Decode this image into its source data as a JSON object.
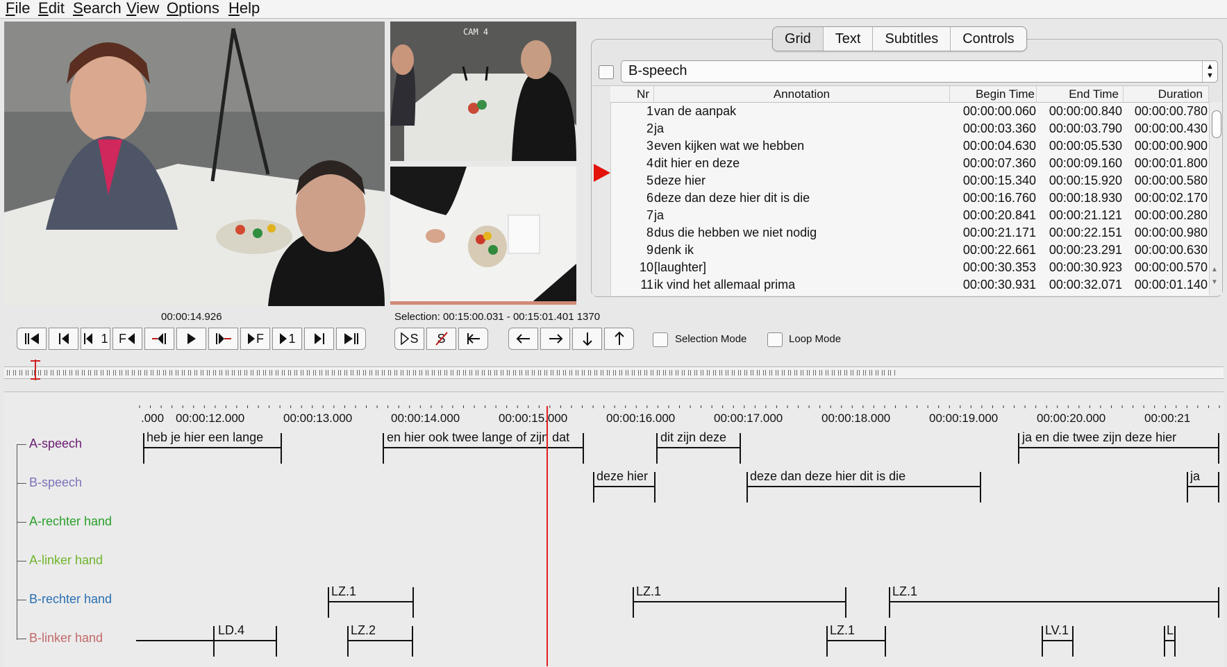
{
  "menu": [
    {
      "label": "File",
      "mnemonic": "F",
      "rest": "ile"
    },
    {
      "label": "Edit",
      "mnemonic": "E",
      "rest": "dit"
    },
    {
      "label": "Search",
      "mnemonic": "S",
      "rest": "earch"
    },
    {
      "label": "View",
      "mnemonic": "V",
      "rest": "iew"
    },
    {
      "label": "Options",
      "mnemonic": "O",
      "rest": "ptions"
    },
    {
      "label": "Help",
      "mnemonic": "H",
      "rest": "elp"
    }
  ],
  "video": {
    "cam_label": "CAM 4"
  },
  "player": {
    "current_time": "00:00:14.926",
    "selection": "Selection: 00:15:00.031 - 00:15:01.401  1370"
  },
  "tabs": [
    "Grid",
    "Text",
    "Subtitles",
    "Controls"
  ],
  "active_tab": "Grid",
  "tier_select": {
    "value": "B-speech"
  },
  "table": {
    "headers": {
      "nr": "Nr",
      "annotation": "Annotation",
      "begin": "Begin Time",
      "end": "End Time",
      "duration": "Duration"
    },
    "rows": [
      {
        "nr": "1",
        "annotation": "van de aanpak",
        "begin": "00:00:00.060",
        "end": "00:00:00.840",
        "duration": "00:00:00.780"
      },
      {
        "nr": "2",
        "annotation": "ja",
        "begin": "00:00:03.360",
        "end": "00:00:03.790",
        "duration": "00:00:00.430"
      },
      {
        "nr": "3",
        "annotation": "even kijken wat we hebben",
        "begin": "00:00:04.630",
        "end": "00:00:05.530",
        "duration": "00:00:00.900"
      },
      {
        "nr": "4",
        "annotation": "dit hier en deze",
        "begin": "00:00:07.360",
        "end": "00:00:09.160",
        "duration": "00:00:01.800"
      },
      {
        "nr": "5",
        "annotation": "deze hier",
        "begin": "00:00:15.340",
        "end": "00:00:15.920",
        "duration": "00:00:00.580"
      },
      {
        "nr": "6",
        "annotation": "deze dan deze hier dit is die",
        "begin": "00:00:16.760",
        "end": "00:00:18.930",
        "duration": "00:00:02.170"
      },
      {
        "nr": "7",
        "annotation": "ja",
        "begin": "00:00:20.841",
        "end": "00:00:21.121",
        "duration": "00:00:00.280"
      },
      {
        "nr": "8",
        "annotation": "dus die hebben we niet nodig",
        "begin": "00:00:21.171",
        "end": "00:00:22.151",
        "duration": "00:00:00.980"
      },
      {
        "nr": "9",
        "annotation": "denk ik",
        "begin": "00:00:22.661",
        "end": "00:00:23.291",
        "duration": "00:00:00.630"
      },
      {
        "nr": "10",
        "annotation": "[laughter]",
        "begin": "00:00:30.353",
        "end": "00:00:30.923",
        "duration": "00:00:00.570"
      },
      {
        "nr": "11",
        "annotation": "ik vind het allemaal prima",
        "begin": "00:00:30.931",
        "end": "00:00:32.071",
        "duration": "00:00:01.140"
      }
    ]
  },
  "controls": {
    "selection_mode": "Selection Mode",
    "loop_mode": "Loop Mode",
    "button_glyphs": {
      "f_back": "F",
      "f_fwd": "F",
      "one_back": "1",
      "one_fwd": "1",
      "sel_s": "S",
      "clear_s": "S"
    }
  },
  "ruler": [
    ".000",
    "00:00:12.000",
    "00:00:13.000",
    "00:00:14.000",
    "00:00:15.000",
    "00:00:16.000",
    "00:00:17.000",
    "00:00:18.000",
    "00:00:19.000",
    "00:00:20.000",
    "00:00:21"
  ],
  "tiers": [
    {
      "name": "A-speech",
      "color": "#6a1b72"
    },
    {
      "name": "B-speech",
      "color": "#7b73b8"
    },
    {
      "name": "A-rechter hand",
      "color": "#2aa02a"
    },
    {
      "name": "A-linker hand",
      "color": "#6fb42d"
    },
    {
      "name": "B-rechter hand",
      "color": "#2a6fb0"
    },
    {
      "name": "B-linker hand",
      "color": "#c26a6a"
    }
  ],
  "timeline_annotations": {
    "a_speech": [
      "heb je hier een lange",
      "en hier ook twee lange of zijn dat",
      "dit zijn deze",
      "ja en die twee zijn deze hier"
    ],
    "b_speech": [
      "deze hier",
      "deze dan deze hier dit is die",
      "ja"
    ],
    "b_rechter": [
      "LZ.1",
      "LZ.1",
      "LZ.1"
    ],
    "b_linker": [
      "LD.4",
      "LZ.2",
      "LZ.1",
      "LV.1",
      "L"
    ]
  }
}
